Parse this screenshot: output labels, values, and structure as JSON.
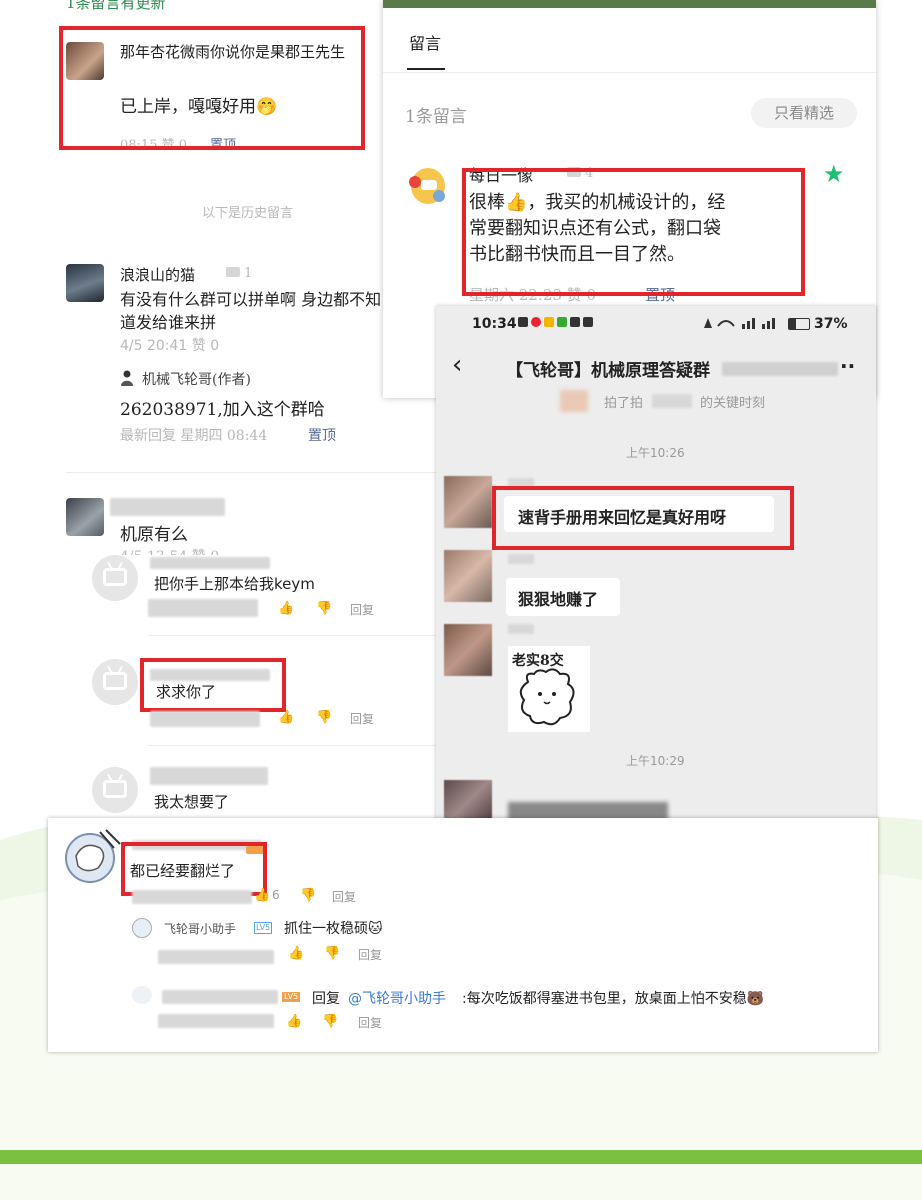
{
  "left_panel": {
    "top_banner": "1条留言有更新",
    "comment1": {
      "name": "那年杏花微雨你说你是果郡王先生",
      "text": "已上岸，嘎嘎好用🤭",
      "meta": "08:15 赞 0",
      "pin": "置顶"
    },
    "history_label": "以下是历史留言",
    "comment2": {
      "name": "浪浪山的猫",
      "reply_count": "1",
      "text": "有没有什么群可以拼单啊 身边都不知道发给谁来拼",
      "meta": "4/5 20:41 赞 0",
      "author_name": "机械飞轮哥(作者)",
      "author_reply": "262038971,加入这个群哈",
      "reply_meta": "最新回复 星期四 08:44",
      "pin": "置顶"
    },
    "comment3": {
      "text": "机原有么",
      "meta": "4/5 13:54 赞 0"
    }
  },
  "right_panel": {
    "tab": "留言",
    "count": "1条留言",
    "filter_button": "只看精选",
    "comment": {
      "name": "每日一像",
      "reply_count": "4",
      "text_line1": "很棒👍，我买的机械设计的，经",
      "text_line2": "常要翻知识点还有公式，翻口袋",
      "text_line3": "书比翻书快而且一目了然。",
      "meta": "星期六 22:23 赞 0",
      "pin": "置顶"
    }
  },
  "bili_panel": {
    "items": [
      {
        "text": "把你手上那本给我keym",
        "reply": "回复"
      },
      {
        "text": "求求你了",
        "reply": "回复"
      },
      {
        "text": "我太想要了"
      }
    ]
  },
  "phone": {
    "status_time": "10:34",
    "battery": "37%",
    "chat_title": "【飞轮哥】机械原理答疑群",
    "more": "··",
    "pat_text": "拍了拍",
    "pat_suffix": "的关键时刻",
    "time1": "上午10:26",
    "msg1": "速背手册用来回忆是真好用呀",
    "msg2": "狠狠地赚了",
    "sticker_text": "老实8交",
    "time2": "上午10:29"
  },
  "bottom_panel": {
    "main_comment": "都已经要翻烂了",
    "like_count": "6",
    "reply_label": "回复",
    "sub1_name": "飞轮哥小助手",
    "sub1_level": "LV5",
    "sub1_text": "抓住一枚稳硕🐱",
    "sub2_level": "LV5",
    "sub2_prefix": "回复",
    "sub2_mention": "@飞轮哥小助手",
    "sub2_text": ":每次吃饭都得塞进书包里，放桌面上怕不安稳🐻"
  },
  "colors": {
    "highlight": "#e0262b",
    "green": "#7cc042",
    "link": "#3a7bd5",
    "star": "#1fbf73"
  }
}
